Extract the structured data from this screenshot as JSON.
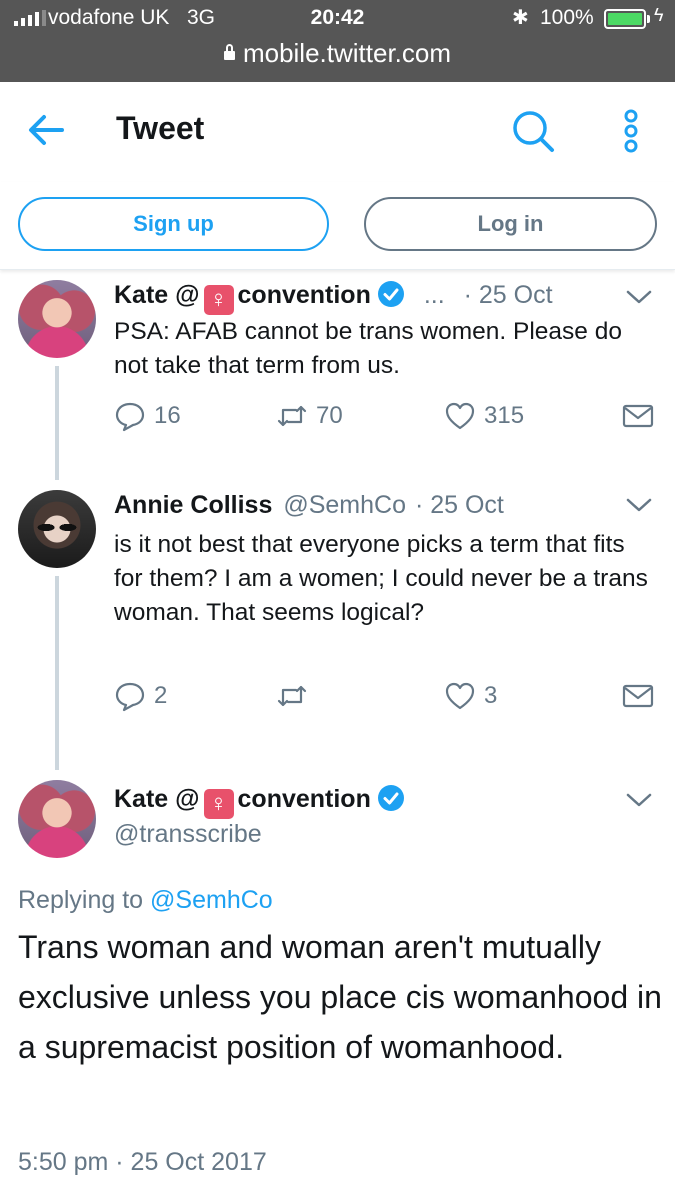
{
  "status_bar": {
    "carrier": "vodafone UK",
    "network": "3G",
    "time": "20:42",
    "battery": "100%",
    "battery_level": 1.0
  },
  "browser": {
    "url": "mobile.twitter.com"
  },
  "header": {
    "title": "Tweet"
  },
  "auth": {
    "signup_label": "Sign up",
    "login_label": "Log in"
  },
  "colors": {
    "accent": "#1da1f2",
    "muted": "#657786",
    "venus_badge": "#e8516b",
    "chrome": "#565656"
  },
  "thread": [
    {
      "name_prefix": "Kate @",
      "name_suffix": "convention",
      "truncation": "...",
      "date": "· 25 Oct",
      "text": "PSA: AFAB cannot be trans women. Please do not take that term from us.",
      "replies": "16",
      "retweets": "70",
      "likes": "315"
    },
    {
      "name": "Annie Colliss",
      "handle": "@SemhCo",
      "date": "· 25 Oct",
      "text": "is it not best that everyone picks a term that fits for them? I am a women; I could never be a trans woman. That seems logical?",
      "replies": "2",
      "retweets": "",
      "likes": "3"
    }
  ],
  "main_tweet": {
    "name_prefix": "Kate @",
    "name_suffix": "convention",
    "handle": "@transscribe",
    "replying_prefix": "Replying to",
    "replying_to": "@SemhCo",
    "text": "Trans woman and woman aren't mutually exclusive unless you place cis womanhood in a supremacist position of womanhood.",
    "timestamp": "5:50 pm · 25 Oct 2017"
  },
  "icons": [
    "signal-icon",
    "bluetooth-icon",
    "battery-icon",
    "lock-icon",
    "back-arrow-icon",
    "search-icon",
    "more-icon",
    "venus-icon",
    "verified-icon",
    "chevron-down-icon",
    "reply-icon",
    "retweet-icon",
    "like-icon",
    "message-icon"
  ]
}
